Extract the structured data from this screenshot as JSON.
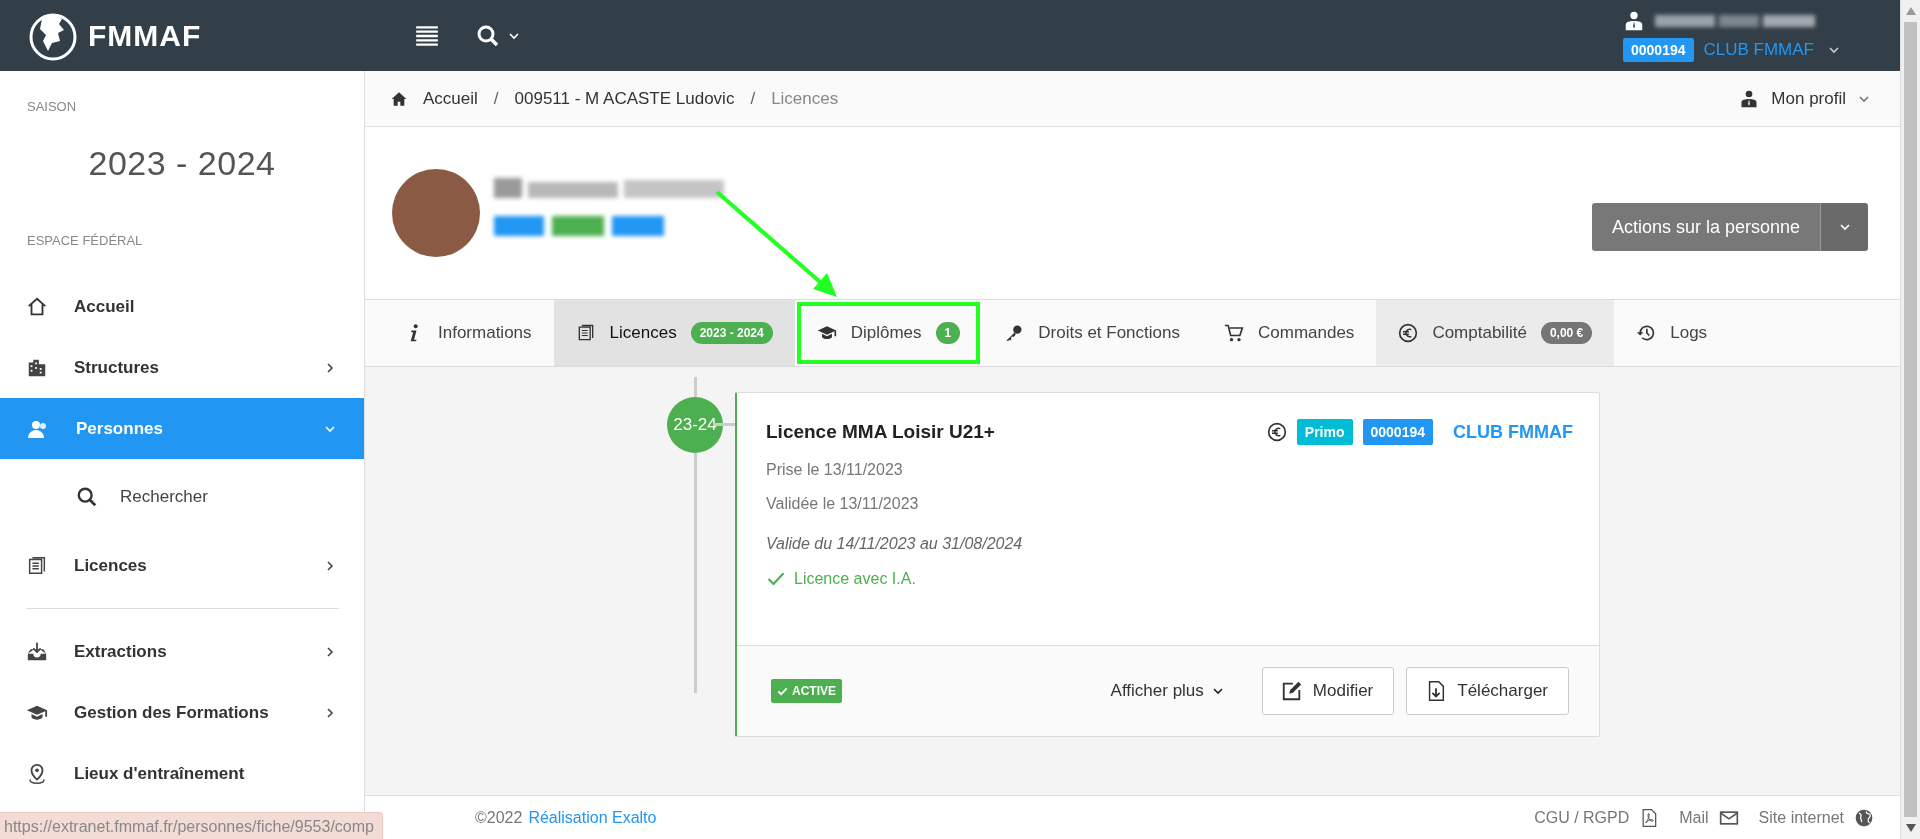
{
  "topbar": {
    "logo": "FMMAF",
    "club_code": "0000194",
    "club_name": "CLUB FMMAF"
  },
  "sidebar": {
    "season_label": "SAISON",
    "season": "2023 - 2024",
    "section_label": "ESPACE FÉDÉRAL",
    "items": [
      {
        "label": "Accueil",
        "expandable": false,
        "selected": false,
        "divider_before": false
      },
      {
        "label": "Structures",
        "expandable": true,
        "expanded": false,
        "selected": false,
        "divider_before": false
      },
      {
        "label": "Personnes",
        "expandable": true,
        "expanded": true,
        "selected": true,
        "divider_before": false,
        "children": [
          {
            "label": "Rechercher"
          }
        ]
      },
      {
        "label": "Licences",
        "expandable": true,
        "expanded": false,
        "selected": false,
        "divider_before": false
      },
      {
        "label": "Extractions",
        "expandable": true,
        "expanded": false,
        "selected": false,
        "divider_before": true
      },
      {
        "label": "Gestion des Formations",
        "expandable": true,
        "expanded": false,
        "selected": false,
        "divider_before": false
      },
      {
        "label": "Lieux d'entraînement",
        "expandable": false,
        "selected": false,
        "divider_before": false
      }
    ]
  },
  "breadcrumb": {
    "separator": "/",
    "items": [
      "Accueil",
      "009511 - M ACASTE Ludovic",
      "Licences"
    ]
  },
  "profile_menu": "Mon profil",
  "person": {
    "actions_button": "Actions sur la personne"
  },
  "tabs": [
    {
      "label": "Informations",
      "selected": false,
      "hovered": false,
      "highlighted": false
    },
    {
      "label": "Licences",
      "badge": {
        "text": "2023 - 2024",
        "color": "#4caf50"
      },
      "selected": true,
      "hovered": false,
      "highlighted": false
    },
    {
      "label": "Diplômes",
      "badge": {
        "text": "1",
        "color": "#4caf50"
      },
      "selected": false,
      "hovered": false,
      "highlighted": true
    },
    {
      "label": "Droits et Fonctions",
      "selected": false,
      "hovered": false,
      "highlighted": false
    },
    {
      "label": "Commandes",
      "selected": false,
      "hovered": false,
      "highlighted": false
    },
    {
      "label": "Comptabilité",
      "badge": {
        "text": "0,00 €",
        "color": "#757575"
      },
      "selected": false,
      "hovered": true,
      "highlighted": false
    },
    {
      "label": "Logs",
      "selected": false,
      "hovered": false,
      "highlighted": false
    }
  ],
  "annotation": {
    "kind": "arrow"
  },
  "licences": [
    {
      "season": "23-24",
      "title": "Licence MMA Loisir U21+",
      "tags": [
        {
          "text": "Primo",
          "color": "#00bcd4"
        },
        {
          "text": "0000194",
          "color": "#2196f3"
        }
      ],
      "club": "CLUB FMMAF",
      "lines": [
        "Prise le 13/11/2023",
        "Validée le 13/11/2023"
      ],
      "validity": "Valide du 14/11/2023 au 31/08/2024",
      "insurance": "Licence avec I.A.",
      "status": "ACTIVE",
      "more": "Afficher plus",
      "buttons": [
        "Modifier",
        "Télécharger"
      ]
    }
  ],
  "footer": {
    "copyright": "©2022",
    "credit": "Réalisation Exalto",
    "links": [
      "CGU / RGPD",
      "Mail",
      "Site internet"
    ]
  },
  "status_url": "https://extranet.fmmaf.fr/personnes/fiche/9553/comp"
}
